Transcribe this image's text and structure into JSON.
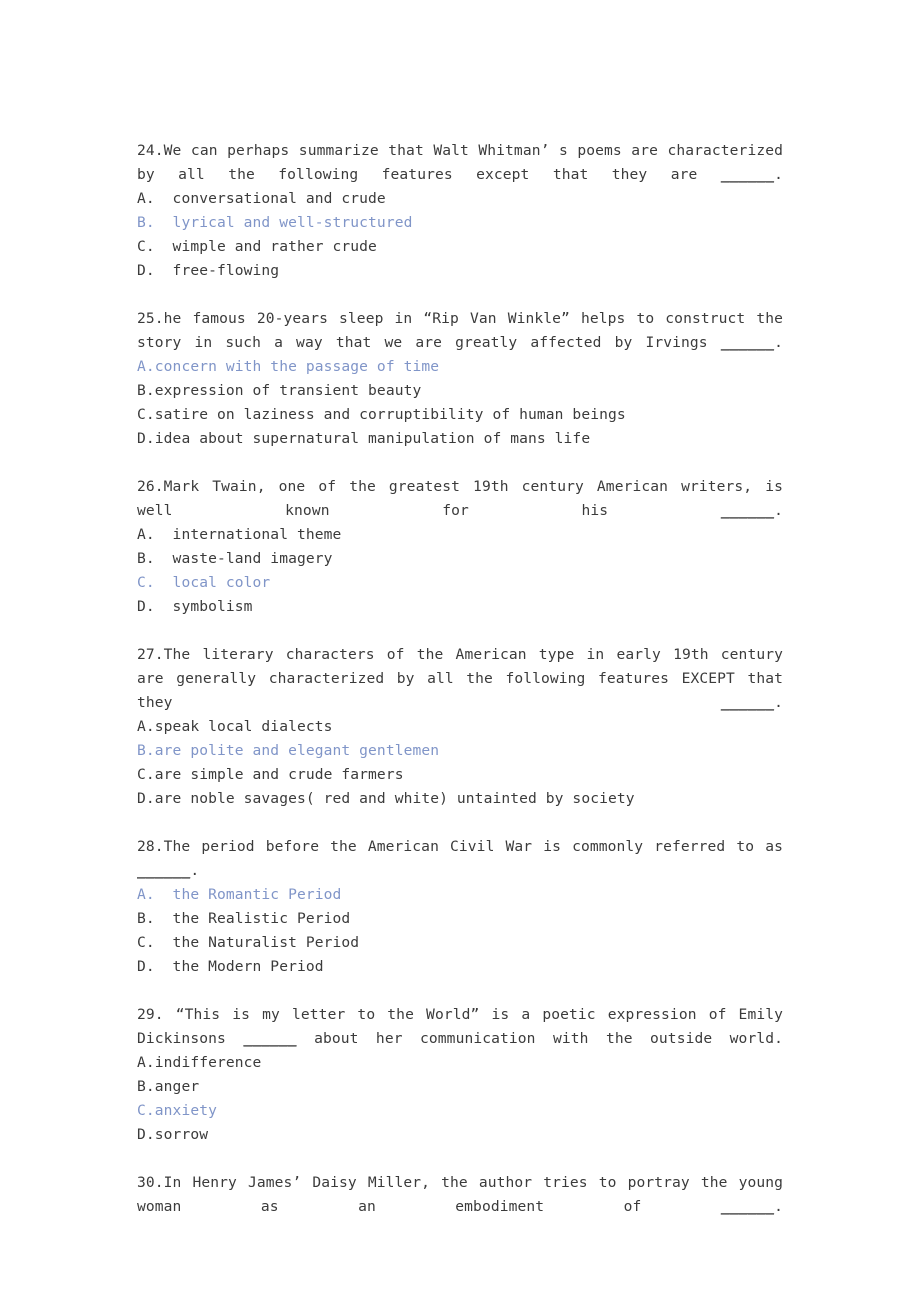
{
  "page": {
    "background_color": "#ffffff",
    "text_color": "#3b3b3b",
    "answer_color": "#8095c8",
    "blank_marker": "______"
  },
  "questions": [
    {
      "number": "24.",
      "stem_line1": "24.We can perhaps summarize that Walt Whitman’ s poems are characterized by all the",
      "stem_line2": "following features except that they are ",
      "stem_tail": ".",
      "options": [
        {
          "label": "A.",
          "text": "  conversational and crude",
          "is_answer": false
        },
        {
          "label": "B.",
          "text": "  lyrical and well-structured",
          "is_answer": true
        },
        {
          "label": "C.",
          "text": "  wimple and rather crude",
          "is_answer": false
        },
        {
          "label": "D.",
          "text": "  free-flowing",
          "is_answer": false
        }
      ]
    },
    {
      "number": "25.",
      "stem_line1": "25.he famous 20-years sleep in “Rip Van Winkle” helps to construct the story in",
      "stem_line2": "such a way that we are greatly affected by Irvings ",
      "stem_tail": ".",
      "options": [
        {
          "label": "A.",
          "text": "concern with the passage of time",
          "is_answer": true
        },
        {
          "label": "B.",
          "text": "expression of transient beauty",
          "is_answer": false
        },
        {
          "label": "C.",
          "text": "satire on laziness and corruptibility of human beings",
          "is_answer": false
        },
        {
          "label": "D.",
          "text": "idea about supernatural manipulation of mans life",
          "is_answer": false
        }
      ]
    },
    {
      "number": "26.",
      "stem_line1": "26.Mark Twain, one of the greatest 19th century American writers, is well known for",
      "stem_line2": "his ",
      "stem_tail": ".",
      "options": [
        {
          "label": "A.",
          "text": "  international theme",
          "is_answer": false
        },
        {
          "label": "B.",
          "text": "  waste-land imagery",
          "is_answer": false
        },
        {
          "label": "C.",
          "text": "  local color",
          "is_answer": true
        },
        {
          "label": "D.",
          "text": "  symbolism",
          "is_answer": false
        }
      ]
    },
    {
      "number": "27.",
      "stem_line1": "27.The literary characters of the American type in early 19th century are generally",
      "stem_line2": "characterized by all the following features EXCEPT that they ",
      "stem_tail": ".",
      "options": [
        {
          "label": "A.",
          "text": "speak local dialects",
          "is_answer": false
        },
        {
          "label": "B.",
          "text": "are polite and elegant gentlemen",
          "is_answer": true
        },
        {
          "label": "C.",
          "text": "are simple and crude farmers",
          "is_answer": false
        },
        {
          "label": "D.",
          "text": "are noble savages( red and white) untainted by society",
          "is_answer": false
        }
      ]
    },
    {
      "number": "28.",
      "stem_line1": "28.The period before the American Civil War is commonly referred to as ",
      "stem_line2": "",
      "stem_tail": ".",
      "options": [
        {
          "label": "A.",
          "text": "  the Romantic Period",
          "is_answer": true
        },
        {
          "label": "B.",
          "text": "  the Realistic Period",
          "is_answer": false
        },
        {
          "label": "C.",
          "text": "  the Naturalist Period",
          "is_answer": false
        },
        {
          "label": "D.",
          "text": "  the Modern Period",
          "is_answer": false
        }
      ]
    },
    {
      "number": "29.",
      "stem_line1": "29. “This is my letter to the World” is a poetic expression of Emily Dickinsons",
      "stem_line2": " about her communication with the outside world.",
      "stem_tail": "",
      "options": [
        {
          "label": "A.",
          "text": "indifference",
          "is_answer": false
        },
        {
          "label": "B.",
          "text": "anger",
          "is_answer": false
        },
        {
          "label": "C.",
          "text": "anxiety",
          "is_answer": true
        },
        {
          "label": "D.",
          "text": "sorrow",
          "is_answer": false
        }
      ]
    },
    {
      "number": "30.",
      "stem_line1": "30.In Henry James’ Daisy Miller, the author tries to portray the young woman as",
      "stem_line2": "an embodiment of ",
      "stem_tail": ".",
      "options": []
    }
  ]
}
